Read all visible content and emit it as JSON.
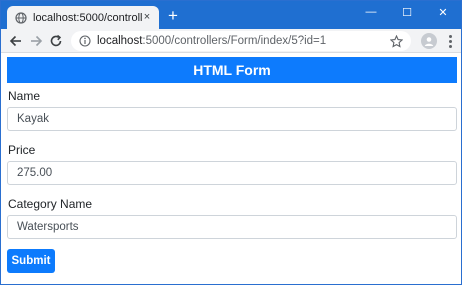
{
  "browser": {
    "tab_title": "localhost:5000/controllers/Form/",
    "url_host": "localhost",
    "url_path": ":5000/controllers/Form/index/5?id=1",
    "tab_close": "×",
    "new_tab": "+",
    "minimize": "—",
    "maximize": "☐",
    "close": "✕",
    "accent": "#1f6fd1"
  },
  "page": {
    "header": "HTML Form",
    "header_color": "#0d7bfd",
    "fields": [
      {
        "label": "Name",
        "value": "Kayak"
      },
      {
        "label": "Price",
        "value": "275.00"
      },
      {
        "label": "Category Name",
        "value": "Watersports"
      }
    ],
    "submit_label": "Submit"
  }
}
